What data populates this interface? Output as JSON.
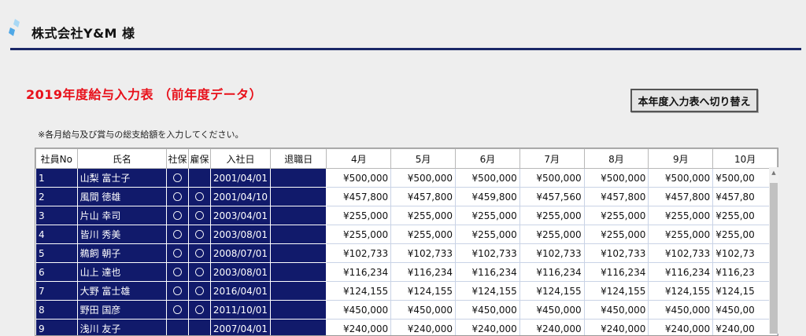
{
  "header": {
    "company": "株式会社Y&M 様",
    "logo_color": "#6cb8ec"
  },
  "page": {
    "title": "2019年度給与入力表 （前年度データ）",
    "switch_button": "本年度入力表へ切り替え",
    "note": "※各月給与及び賞与の総支給額を入力してください。"
  },
  "table": {
    "headers": [
      "社員No",
      "氏名",
      "社保",
      "雇保",
      "入社日",
      "退職日",
      "4月",
      "5月",
      "6月",
      "7月",
      "8月",
      "9月",
      "10月"
    ],
    "rows": [
      {
        "no": "1",
        "name": "山梨 富士子",
        "shaho": "〇",
        "koho": "",
        "hired": "2001/04/01",
        "retired": "",
        "m4": "¥500,000",
        "m5": "¥500,000",
        "m6": "¥500,000",
        "m7": "¥500,000",
        "m8": "¥500,000",
        "m9": "¥500,000",
        "m10": "¥500,00"
      },
      {
        "no": "2",
        "name": "風間 徳雄",
        "shaho": "〇",
        "koho": "〇",
        "hired": "2001/04/10",
        "retired": "",
        "m4": "¥457,800",
        "m5": "¥457,800",
        "m6": "¥459,800",
        "m7": "¥457,560",
        "m8": "¥457,800",
        "m9": "¥457,800",
        "m10": "¥457,80"
      },
      {
        "no": "3",
        "name": "片山 幸司",
        "shaho": "〇",
        "koho": "〇",
        "hired": "2003/04/01",
        "retired": "",
        "m4": "¥255,000",
        "m5": "¥255,000",
        "m6": "¥255,000",
        "m7": "¥255,000",
        "m8": "¥255,000",
        "m9": "¥255,000",
        "m10": "¥255,00"
      },
      {
        "no": "4",
        "name": "皆川 秀美",
        "shaho": "〇",
        "koho": "〇",
        "hired": "2003/08/01",
        "retired": "",
        "m4": "¥255,000",
        "m5": "¥255,000",
        "m6": "¥255,000",
        "m7": "¥255,000",
        "m8": "¥255,000",
        "m9": "¥255,000",
        "m10": "¥255,00"
      },
      {
        "no": "5",
        "name": "鵜飼 朝子",
        "shaho": "〇",
        "koho": "〇",
        "hired": "2008/07/01",
        "retired": "",
        "m4": "¥102,733",
        "m5": "¥102,733",
        "m6": "¥102,733",
        "m7": "¥102,733",
        "m8": "¥102,733",
        "m9": "¥102,733",
        "m10": "¥102,73"
      },
      {
        "no": "6",
        "name": "山上 達也",
        "shaho": "〇",
        "koho": "〇",
        "hired": "2003/08/01",
        "retired": "",
        "m4": "¥116,234",
        "m5": "¥116,234",
        "m6": "¥116,234",
        "m7": "¥116,234",
        "m8": "¥116,234",
        "m9": "¥116,234",
        "m10": "¥116,23"
      },
      {
        "no": "7",
        "name": "大野 富士雄",
        "shaho": "〇",
        "koho": "〇",
        "hired": "2016/04/01",
        "retired": "",
        "m4": "¥124,155",
        "m5": "¥124,155",
        "m6": "¥124,155",
        "m7": "¥124,155",
        "m8": "¥124,155",
        "m9": "¥124,155",
        "m10": "¥124,15"
      },
      {
        "no": "8",
        "name": "野田 国彦",
        "shaho": "〇",
        "koho": "〇",
        "hired": "2011/10/01",
        "retired": "",
        "m4": "¥450,000",
        "m5": "¥450,000",
        "m6": "¥450,000",
        "m7": "¥450,000",
        "m8": "¥450,000",
        "m9": "¥450,000",
        "m10": "¥450,00"
      },
      {
        "no": "9",
        "name": "浅川 友子",
        "shaho": "",
        "koho": "",
        "hired": "2007/04/01",
        "retired": "",
        "m4": "¥240,000",
        "m5": "¥240,000",
        "m6": "¥240,000",
        "m7": "¥240,000",
        "m8": "¥240,000",
        "m9": "¥240,000",
        "m10": "¥240,00"
      }
    ]
  },
  "colors": {
    "navy": "#111a6b",
    "title_red": "#e8101a",
    "rule": "#1a2767"
  }
}
